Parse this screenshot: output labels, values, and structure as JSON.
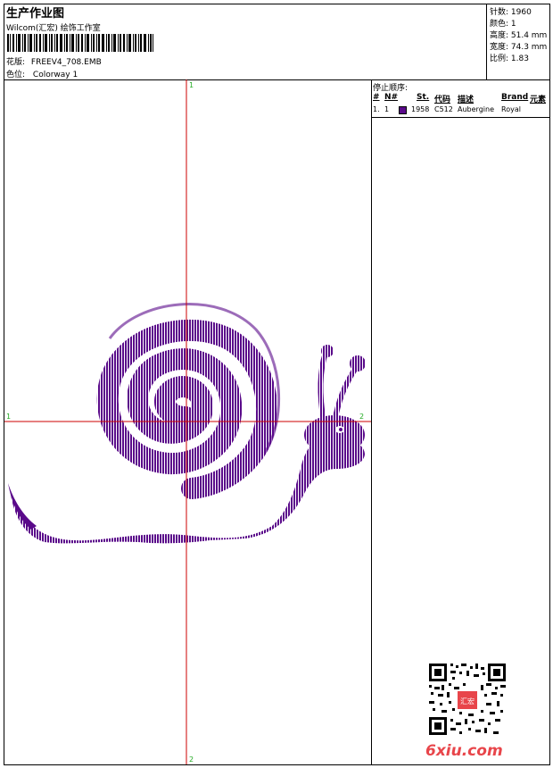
{
  "header": {
    "title": "生产作业图",
    "studio": "Wilcom(汇宏) 绘饰工作室",
    "design_label": "花版:",
    "design_value": "FREEV4_708.EMB",
    "colorway_label": "色位:",
    "colorway_value": "Colorway 1"
  },
  "stats": {
    "stitches": "针数: 1960",
    "colors": "颜色: 1",
    "height": "高度: 51.4 mm",
    "width": "宽度: 74.3 mm",
    "scale": "比例: 1.83"
  },
  "axes": {
    "top": "1",
    "bottom": "2",
    "left": "1",
    "right": "2",
    "color": "#cc0000",
    "label_color": "#22aa22"
  },
  "stop_sequence": {
    "title": "停止顺序:",
    "columns": [
      "#",
      "N#",
      "St.",
      "代码",
      "描述",
      "Brand",
      "元素"
    ],
    "rows": [
      {
        "index": "1.",
        "needle": "1",
        "stitches": "1958",
        "code": "C512",
        "description": "Aubergine",
        "brand": "Royal",
        "swatch": "#5a0a8a"
      }
    ]
  },
  "design_color": "#5a0a8a",
  "watermark": "6xiu.com",
  "stamp_text": "汇宏"
}
